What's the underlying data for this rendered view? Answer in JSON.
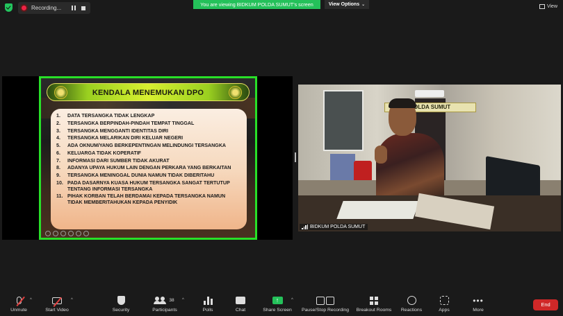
{
  "topbar": {
    "recording_label": "Recording...",
    "share_banner": "You are viewing BIDKUM POLDA SUMUT's screen",
    "view_options": "View Options",
    "view_button": "View"
  },
  "slide": {
    "title": "KENDALA MENEMUKAN DPO",
    "items": [
      {
        "num": "1.",
        "text": "DATA TERSANGKA TIDAK LENGKAP"
      },
      {
        "num": "2.",
        "text": "TERSANGKA BERPINDAH-PINDAH TEMPAT TINGGAL"
      },
      {
        "num": "3.",
        "text": "TERSANGKA MENGGANTI IDENTITAS DIRI"
      },
      {
        "num": "4.",
        "text": "TERSANGKA MELARIKAN DIRI KELUAR NEGERI"
      },
      {
        "num": "5.",
        "text": "ADA OKNUM/YANG BERKEPENTINGAN MELINDUNGI TERSANGKA"
      },
      {
        "num": "6.",
        "text": "KELUARGA TIDAK KOPERATIF"
      },
      {
        "num": "7.",
        "text": "INFORMASI DARI SUMBER TIDAK AKURAT"
      },
      {
        "num": "8.",
        "text": "ADANYA UPAYA HUKUM LAIN DENGAN PERKARA YANG BERKAITAN"
      },
      {
        "num": "9.",
        "text": "TERSANGKA MENINGGAL DUNIA NAMUN TIDAK DIBERITAHU"
      },
      {
        "num": "10.",
        "text": "PADA DASARNYA KUASA HUKUM TERSANGKA SANGAT TERTUTUP TENTANG INFORMASI TERSANGKA"
      },
      {
        "num": "11.",
        "text": "PIHAK KORBAN TELAH BERDAMAI KEPADA TERSANGKA NAMUN TIDAK MEMBERITAHUKAN KEPADA PENYIDIK"
      }
    ]
  },
  "video": {
    "participant_name": "BIDKUM POLDA SUMUT",
    "sign_text": "POLDA SUMUT"
  },
  "toolbar": {
    "unmute": "Unmute",
    "start_video": "Start Video",
    "security": "Security",
    "participants": "Participants",
    "participants_count": "38",
    "polls": "Polls",
    "chat": "Chat",
    "share_screen": "Share Screen",
    "pause_stop_recording": "Pause/Stop Recording",
    "breakout_rooms": "Breakout Rooms",
    "reactions": "Reactions",
    "apps": "Apps",
    "more": "More",
    "end": "End"
  },
  "colors": {
    "share_green": "#24c15a",
    "slide_border": "#28e028",
    "end_red": "#d02828"
  }
}
